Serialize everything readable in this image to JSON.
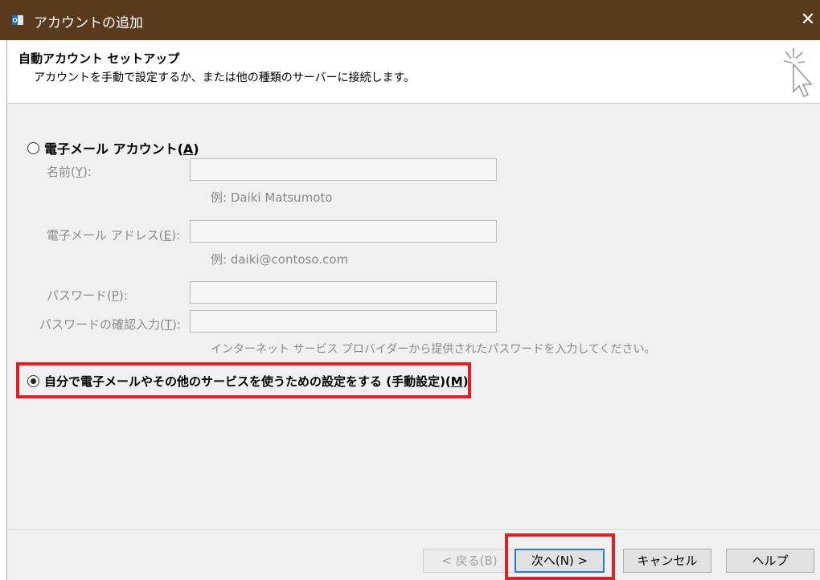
{
  "window": {
    "title": "アカウントの追加",
    "close_glyph": "✕"
  },
  "header": {
    "title": "自動アカウント セットアップ",
    "subtitle": "アカウントを手動で設定するか、または他の種類のサーバーに接続します。"
  },
  "email_account_option": {
    "label": "電子メール アカウント(",
    "accel": "A",
    "label_end": ")",
    "selected": false
  },
  "fields": [
    {
      "label": "名前(",
      "accel": "Y",
      "label_end": "):",
      "value": ""
    },
    {
      "label": "電子メール アドレス(",
      "accel": "E",
      "label_end": "):",
      "value": ""
    },
    {
      "label": "パスワード(",
      "accel": "P",
      "label_end": "):",
      "value": ""
    },
    {
      "label": "パスワードの確認入力(",
      "accel": "T",
      "label_end": "):",
      "value": ""
    }
  ],
  "hints": {
    "name": "例: Daiki Matsumoto",
    "email": "例: daiki@contoso.com",
    "password": "インターネット サービス プロバイダーから提供されたパスワードを入力してください。"
  },
  "manual_option": {
    "label": "自分で電子メールやその他のサービスを使うための設定をする (手動設定)(",
    "accel": "M",
    "label_end": ")",
    "selected": true
  },
  "buttons": {
    "back": "< 戻る(B)",
    "next": "次へ(N) >",
    "cancel": "キャンセル",
    "help": "ヘルプ"
  },
  "highlight_color": "#e01e26"
}
